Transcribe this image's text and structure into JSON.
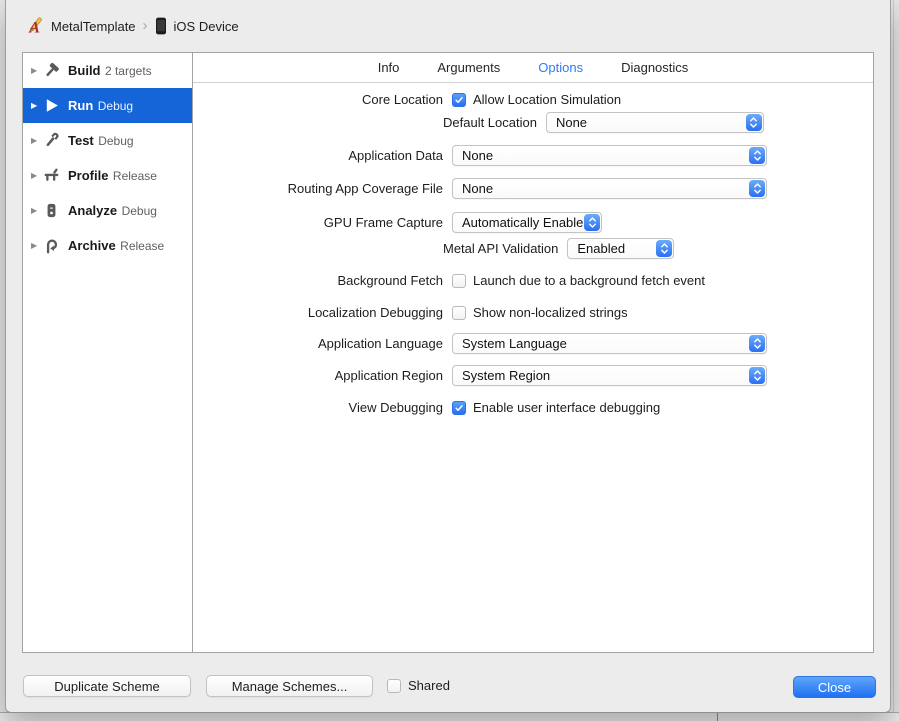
{
  "window": {
    "breadcrumb": {
      "scheme_name": "MetalTemplate",
      "separator": "›",
      "destination_name": "iOS Device",
      "app_icon": "xcode-app-icon",
      "destination_icon": "ios-device-icon"
    }
  },
  "sidebar": {
    "items": [
      {
        "label": "Build",
        "sublabel": "2 targets",
        "icon": "hammer-icon",
        "selected": false
      },
      {
        "label": "Run",
        "sublabel": "Debug",
        "icon": "play-icon",
        "selected": true
      },
      {
        "label": "Test",
        "sublabel": "Debug",
        "icon": "wrench-icon",
        "selected": false
      },
      {
        "label": "Profile",
        "sublabel": "Release",
        "icon": "caliper-icon",
        "selected": false
      },
      {
        "label": "Analyze",
        "sublabel": "Debug",
        "icon": "analyze-icon",
        "selected": false
      },
      {
        "label": "Archive",
        "sublabel": "Release",
        "icon": "archive-icon",
        "selected": false
      }
    ]
  },
  "tabs": [
    {
      "label": "Info",
      "selected": false
    },
    {
      "label": "Arguments",
      "selected": false
    },
    {
      "label": "Options",
      "selected": true
    },
    {
      "label": "Diagnostics",
      "selected": false
    }
  ],
  "form": {
    "rows": [
      {
        "label": "Core Location",
        "control": "checkbox",
        "checkbox_label": "Allow Location Simulation",
        "checked": true
      },
      {
        "label": "Default Location",
        "control": "dropdown",
        "value": "None",
        "indented": true
      },
      {
        "label": "Application Data",
        "control": "dropdown",
        "value": "None"
      },
      {
        "label": "Routing App Coverage File",
        "control": "dropdown",
        "value": "None"
      },
      {
        "label": "GPU Frame Capture",
        "control": "dropdown",
        "value": "Automatically Enabled"
      },
      {
        "label": "Metal API Validation",
        "control": "dropdown",
        "value": "Enabled",
        "indented": true
      },
      {
        "label": "Background Fetch",
        "control": "checkbox",
        "checkbox_label": "Launch due to a background fetch event",
        "checked": false
      },
      {
        "label": "Localization Debugging",
        "control": "checkbox",
        "checkbox_label": "Show non-localized strings",
        "checked": false
      },
      {
        "label": "Application Language",
        "control": "dropdown",
        "value": "System Language"
      },
      {
        "label": "Application Region",
        "control": "dropdown",
        "value": "System Region"
      },
      {
        "label": "View Debugging",
        "control": "checkbox",
        "checkbox_label": "Enable user interface debugging",
        "checked": true
      }
    ]
  },
  "footer": {
    "duplicate_button": "Duplicate Scheme",
    "manage_button": "Manage Schemes...",
    "shared_label": "Shared",
    "shared_checked": false,
    "close_button": "Close"
  },
  "colors": {
    "selection_blue": "#1565d8",
    "control_accent_blue": "#3f87f6",
    "tab_selected_blue": "#2e7cf6",
    "close_button_blue": "#2a72f2",
    "panel_gray": "#ececec"
  }
}
